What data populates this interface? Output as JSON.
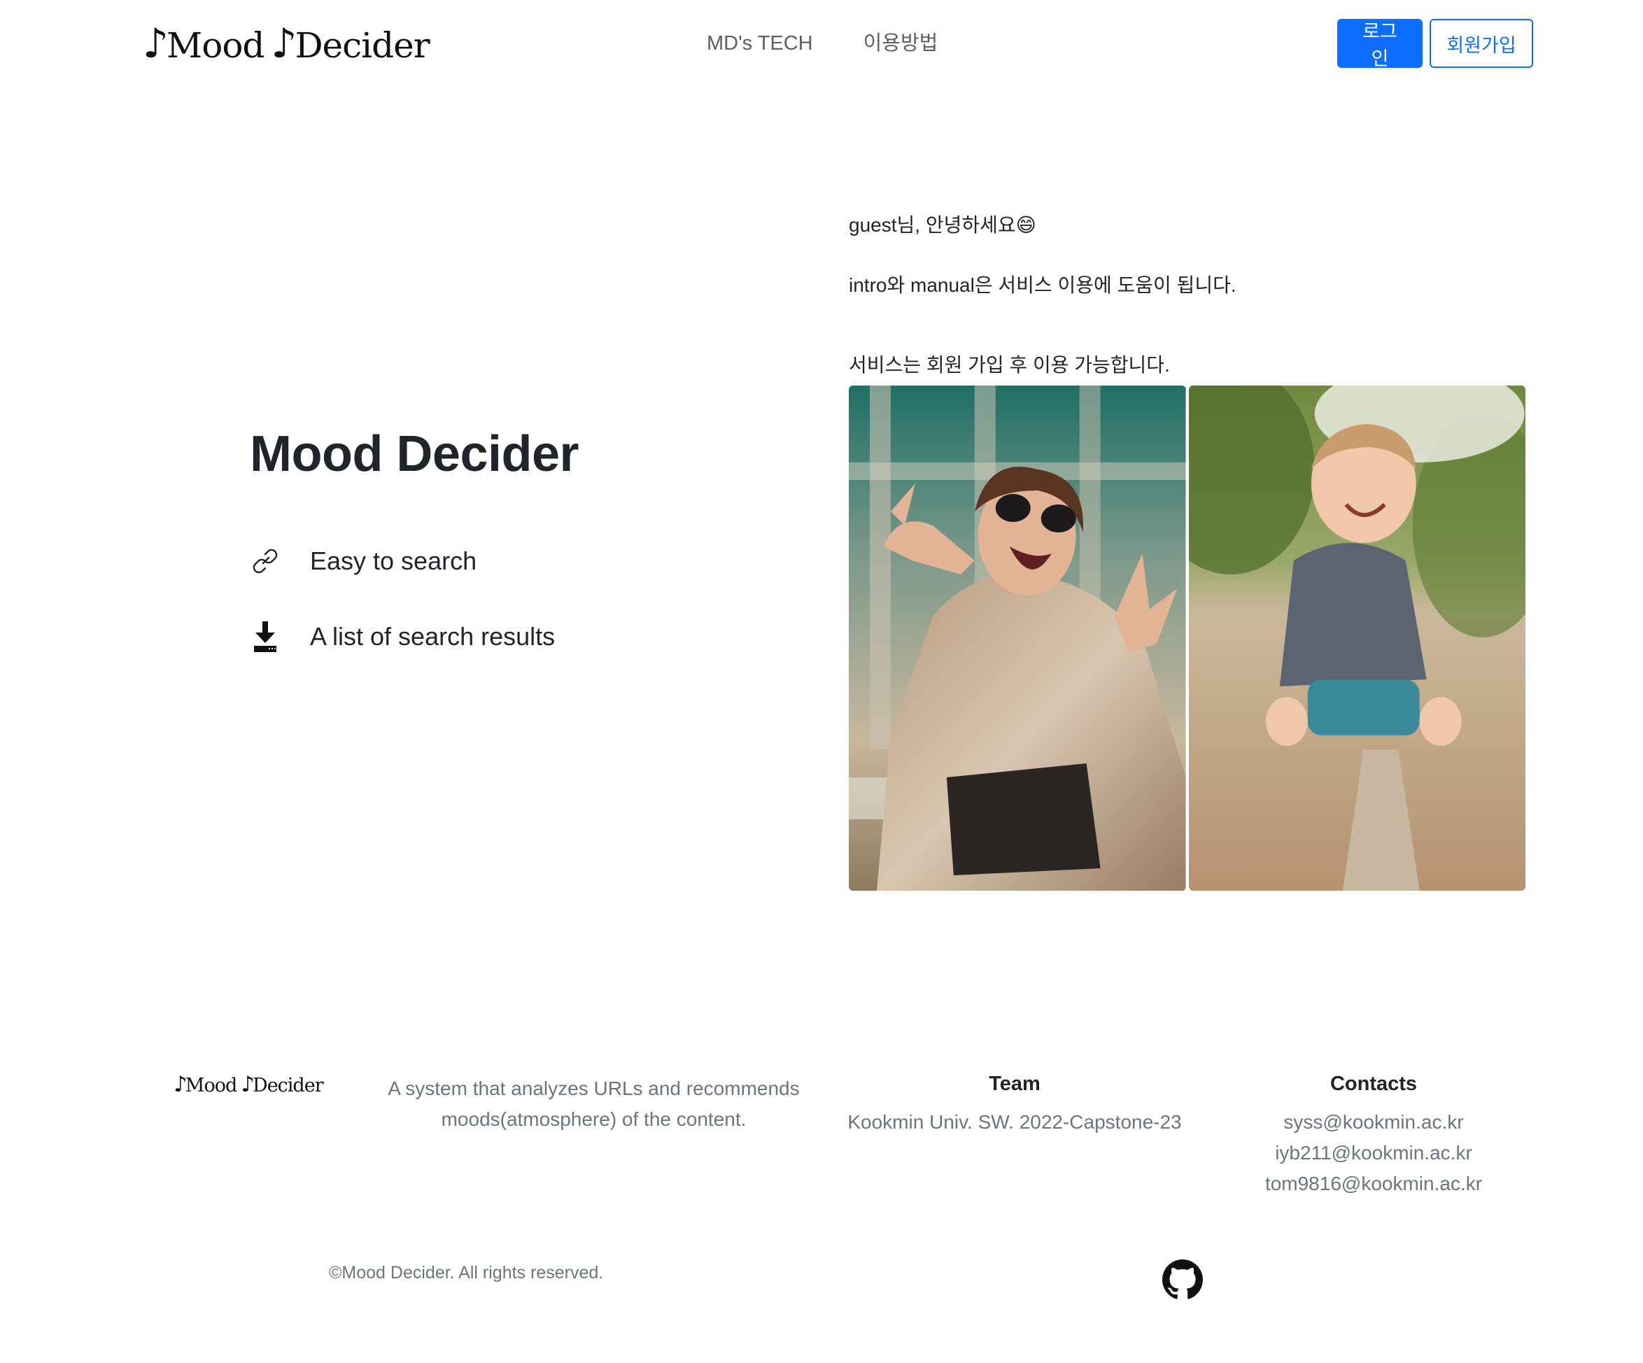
{
  "header": {
    "logo_note": "♪",
    "logo_word_1": "Mood",
    "logo_word_2": "Decider",
    "nav": [
      "MD's TECH",
      "이용방법"
    ],
    "login_label": "로그인",
    "signup_label": "회원가입"
  },
  "hero": {
    "title": "Mood Decider",
    "features": [
      {
        "icon": "link-icon",
        "label": "Easy to search"
      },
      {
        "icon": "download-icon",
        "label": "A list of search results"
      }
    ],
    "greeting": "guest님, 안녕하세요😄",
    "intro_text": "intro와 manual은 서비스 이용에 도움이 됩니다.",
    "notice": "서비스는 회원 가입 후 이용 가능합니다."
  },
  "footer": {
    "description": "A system that analyzes URLs and recommends moods(atmosphere) of the content.",
    "team_heading": "Team",
    "team_text": "Kookmin Univ. SW. 2022-Capstone-23",
    "contacts_heading": "Contacts",
    "contacts": [
      "syss@kookmin.ac.kr",
      "iyb211@kookmin.ac.kr",
      "tom9816@kookmin.ac.kr"
    ],
    "copyright": "©Mood Decider. All rights reserved.",
    "github_icon": "github-icon"
  },
  "colors": {
    "primary": "#0d6efd",
    "text": "#212529",
    "muted": "#6c757d",
    "nav": "#5b6066"
  }
}
